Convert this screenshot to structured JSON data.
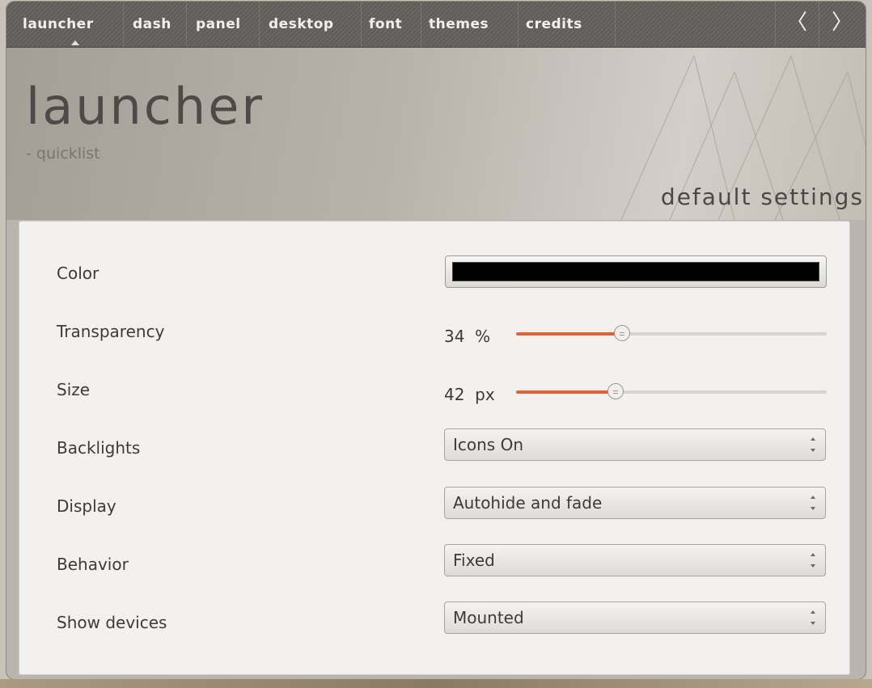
{
  "nav": {
    "tabs": [
      "launcher",
      "dash",
      "panel",
      "desktop",
      "font",
      "themes",
      "credits"
    ],
    "back_icon": "chevron-left-icon",
    "forward_icon": "chevron-right-icon"
  },
  "header": {
    "title": "launcher",
    "subtitle": "- quicklist",
    "defaults_label": "default settings"
  },
  "settings": {
    "color": {
      "label": "Color",
      "value": "#000000"
    },
    "transparency": {
      "label": "Transparency",
      "value": "34",
      "unit": "%",
      "level": 0.34
    },
    "size": {
      "label": "Size",
      "value": "42",
      "unit": "px",
      "level": 0.32
    },
    "backlights": {
      "label": "Backlights",
      "selected": "Icons On"
    },
    "display": {
      "label": "Display",
      "selected": "Autohide and fade"
    },
    "behavior": {
      "label": "Behavior",
      "selected": "Fixed"
    },
    "show_devices": {
      "label": "Show devices",
      "selected": "Mounted"
    }
  },
  "colors": {
    "accent": "#e0603a",
    "nav_bg": "#5e5b58"
  }
}
